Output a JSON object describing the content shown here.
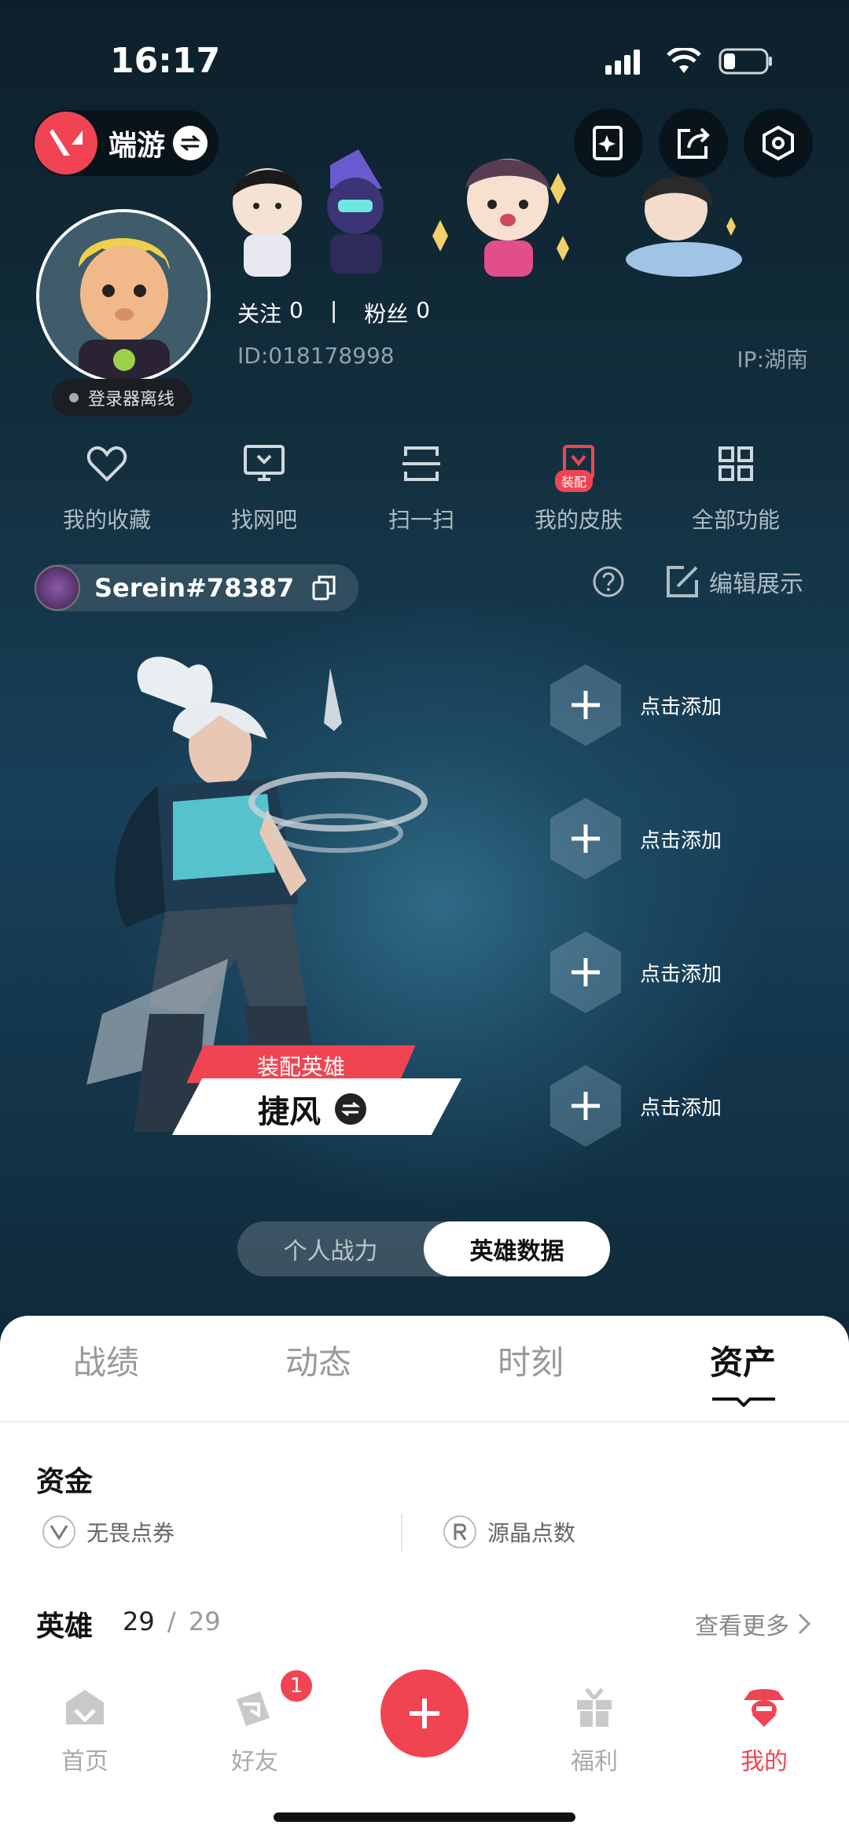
{
  "status_bar": {
    "time": "16:17"
  },
  "header": {
    "game_name": "端游",
    "follow_label": "关注",
    "follow_count": "0",
    "separator": "|",
    "fans_label": "粉丝",
    "fans_count": "0",
    "user_id": "ID:018178998",
    "ip": "IP:湖南",
    "offline_status": "登录器离线"
  },
  "shortcuts": [
    {
      "label": "我的收藏",
      "icon": "heart-icon"
    },
    {
      "label": "找网吧",
      "icon": "monitor-icon"
    },
    {
      "label": "扫一扫",
      "icon": "scan-icon"
    },
    {
      "label": "我的皮肤",
      "icon": "skin-icon",
      "badge": "装配"
    },
    {
      "label": "全部功能",
      "icon": "grid-icon"
    }
  ],
  "player": {
    "riot_id": "Serein#78387",
    "edit_label": "编辑展示"
  },
  "agent": {
    "equip_label": "装配英雄",
    "name": "捷风"
  },
  "slots": [
    {
      "label": "点击添加"
    },
    {
      "label": "点击添加"
    },
    {
      "label": "点击添加"
    },
    {
      "label": "点击添加"
    }
  ],
  "segmented": {
    "options": [
      "个人战力",
      "英雄数据"
    ],
    "selected": "英雄数据"
  },
  "tabs": {
    "items": [
      "战绩",
      "动态",
      "时刻",
      "资产"
    ],
    "selected": "资产"
  },
  "assets": {
    "funds_title": "资金",
    "funds": [
      {
        "label": "无畏点券",
        "icon": "vp-coin-icon"
      },
      {
        "label": "源晶点数",
        "icon": "radianite-coin-icon"
      }
    ],
    "heroes_title": "英雄",
    "heroes_owned": "29",
    "heroes_total": "29",
    "heroes_sep": "/",
    "more_label": "查看更多"
  },
  "nav": {
    "items": [
      {
        "label": "首页",
        "icon": "home-icon"
      },
      {
        "label": "好友",
        "icon": "friends-icon",
        "badge": "1"
      },
      {
        "label": "",
        "icon": "plus-icon"
      },
      {
        "label": "福利",
        "icon": "gift-icon"
      },
      {
        "label": "我的",
        "icon": "profile-icon"
      }
    ],
    "active": "我的"
  },
  "colors": {
    "accent": "#f04452",
    "sheet_bg": "#ffffff",
    "hero_bg": "#18405a"
  }
}
